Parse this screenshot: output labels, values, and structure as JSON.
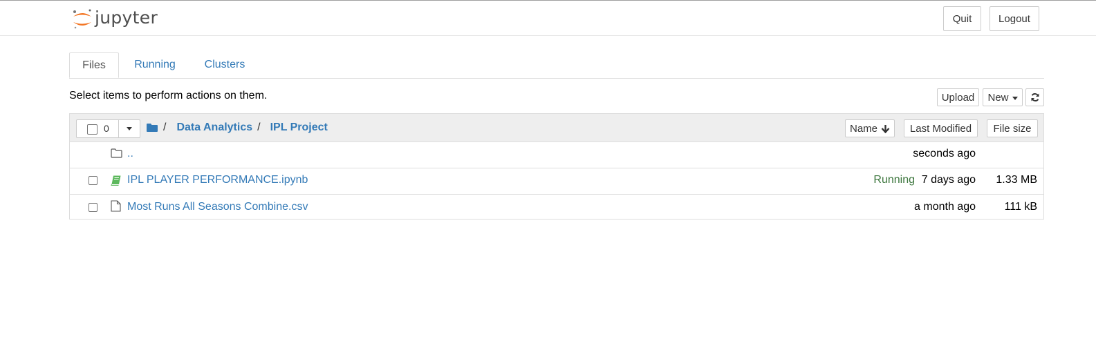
{
  "header": {
    "logo_text": "jupyter",
    "quit_label": "Quit",
    "logout_label": "Logout"
  },
  "tabs": [
    {
      "label": "Files",
      "active": true
    },
    {
      "label": "Running",
      "active": false
    },
    {
      "label": "Clusters",
      "active": false
    }
  ],
  "toolbar": {
    "hint": "Select items to perform actions on them.",
    "upload_label": "Upload",
    "new_label": "New",
    "refresh_icon": "refresh-icon"
  },
  "list_header": {
    "selected_count": "0",
    "breadcrumb_sep": "/",
    "breadcrumbs": [
      "Data Analytics",
      "IPL Project"
    ],
    "sort_name_label": "Name",
    "sort_modified_label": "Last Modified",
    "sort_size_label": "File size"
  },
  "files": [
    {
      "name": "..",
      "icon": "folder-icon",
      "status": "",
      "modified": "seconds ago",
      "size": ""
    },
    {
      "name": "IPL PLAYER PERFORMANCE.ipynb",
      "icon": "notebook-icon",
      "status": "Running",
      "modified": "7 days ago",
      "size": "1.33 MB"
    },
    {
      "name": "Most Runs All Seasons Combine.csv",
      "icon": "file-icon",
      "status": "",
      "modified": "a month ago",
      "size": "111 kB"
    }
  ],
  "colors": {
    "link": "#337ab7",
    "running": "#3c763d",
    "logo_orange": "#f37726",
    "notebook_green": "#5cb85c"
  }
}
